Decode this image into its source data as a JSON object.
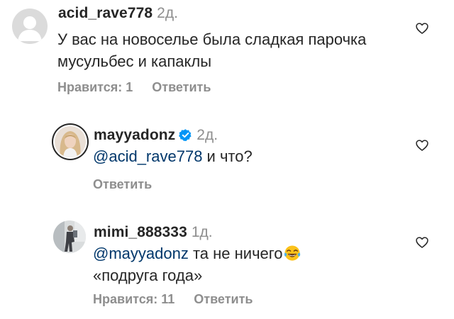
{
  "comments": [
    {
      "username": "acid_rave778",
      "time": "2д.",
      "text_lines": [
        "У вас на новоселье была сладкая парочка",
        "мусульбес и капаклы"
      ],
      "likes_label": "Нравится: 1",
      "reply_label": "Ответить",
      "avatar": "default-avatar-icon"
    },
    {
      "username": "mayyadonz",
      "verified": true,
      "time": "2д.",
      "mention": "@acid_rave778",
      "text_after_mention": " и что?",
      "reply_label": "Ответить",
      "avatar": "story-ring-photo-avatar"
    },
    {
      "username": "mimi_888333",
      "time": "1д.",
      "mention": "@mayyadonz",
      "text_after_mention": " та не ничего",
      "emoji": "face-with-tears-of-joy-icon",
      "text_line2": "«подруга года»",
      "likes_label": "Нравится: 11",
      "reply_label": "Ответить",
      "avatar": "photo-avatar"
    }
  ],
  "colors": {
    "text": "#262626",
    "secondary": "#8e8e8e",
    "mention": "#00376b",
    "verified": "#0095f6"
  },
  "icons": {
    "like": "heart-outline-icon"
  }
}
